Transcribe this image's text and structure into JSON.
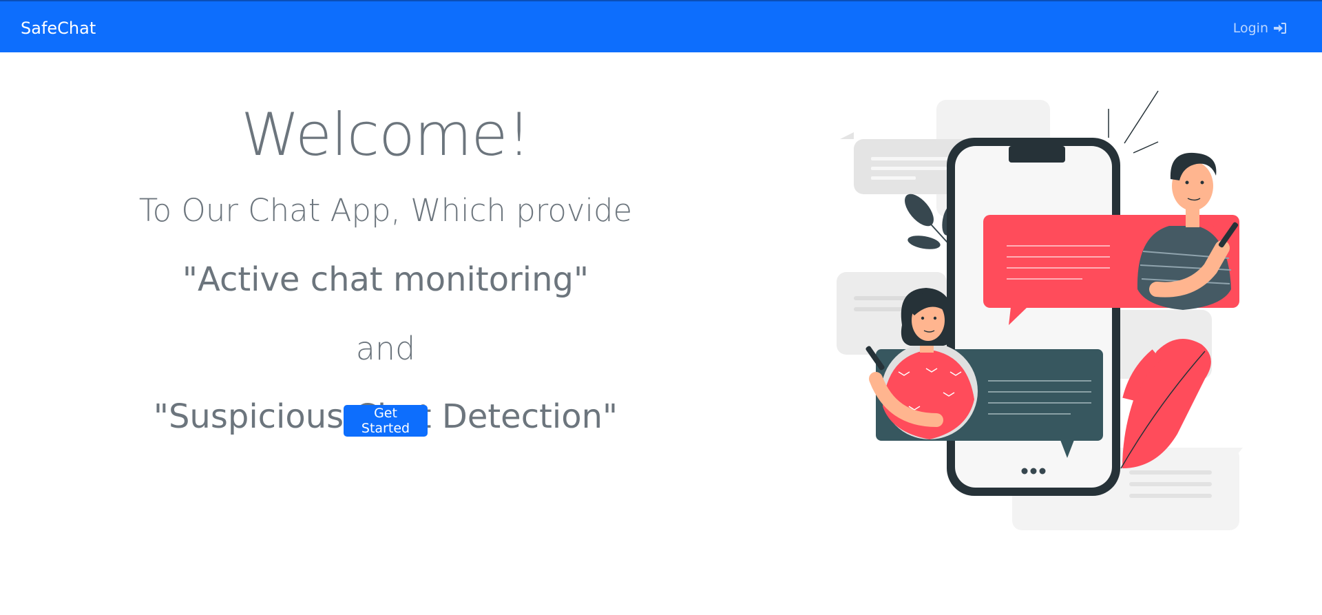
{
  "navbar": {
    "brand": "SafeChat",
    "login_label": "Login",
    "login_icon": "sign-in-icon",
    "background": "#0d6efd"
  },
  "hero": {
    "title": "Welcome!",
    "subtitle": "To Our Chat App, Which provide",
    "feature_one": "\"Active chat monitoring\"",
    "connector": "and",
    "feature_two": "\"Suspicious Chat Detection\"",
    "cta_label": "Get Started",
    "text_color": "#6c757d"
  },
  "illustration": {
    "icon": "people-chatting-illustration",
    "typing_indicator": "•••"
  }
}
